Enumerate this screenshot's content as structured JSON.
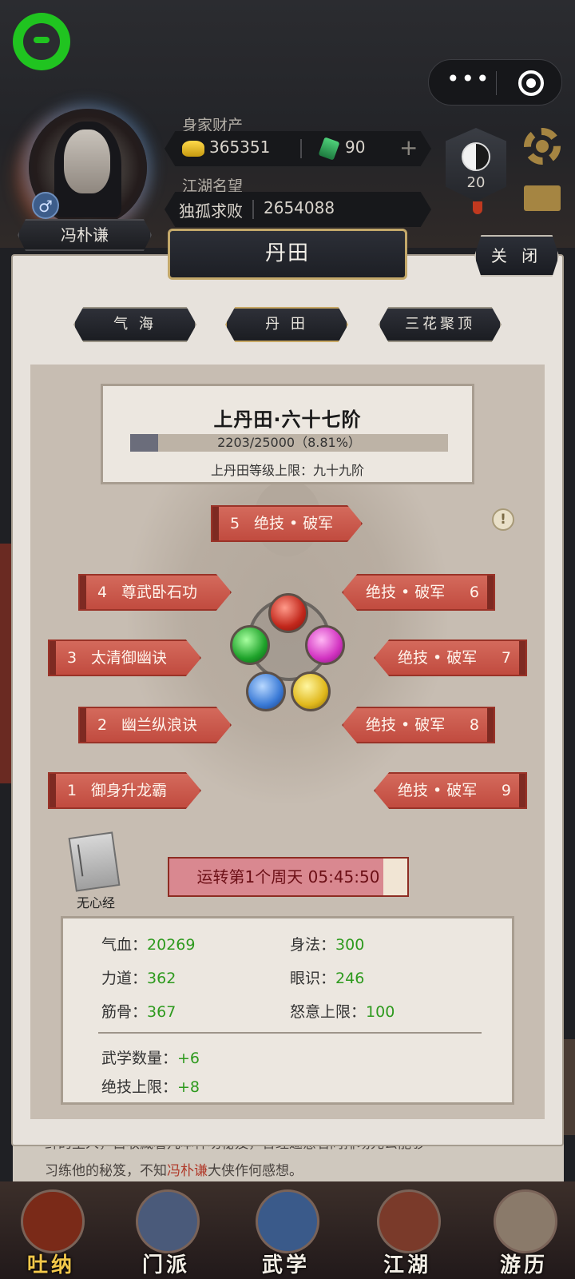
{
  "header": {
    "wealth_label": "身家财产",
    "gold_amount": "365351",
    "jade_amount": "90",
    "plus_symbol": "+",
    "fame_label": "江湖名望",
    "fame_title": "独孤求败",
    "fame_value": "2654088",
    "player_name": "冯朴谦",
    "gender_symbol": "♂",
    "rank_level": "20",
    "capsule_more": "•••"
  },
  "panel": {
    "title": "丹田",
    "close_label": "关 闭",
    "tabs": [
      {
        "label": "气 海"
      },
      {
        "label": "丹 田"
      },
      {
        "label": "三花聚顶"
      }
    ],
    "level": {
      "title": "上丹田·六十七阶",
      "progress_text": "2203/25000（8.81%）",
      "progress_fraction": 0.0881,
      "cap_text": "上丹田等级上限：九十九阶"
    },
    "info_symbol": "!",
    "skills_left": [
      {
        "num": "5",
        "name": "绝技 • 破军"
      },
      {
        "num": "4",
        "name": "尊武卧石功"
      },
      {
        "num": "3",
        "name": "太清御幽诀"
      },
      {
        "num": "2",
        "name": "幽兰纵浪诀"
      },
      {
        "num": "1",
        "name": "御身升龙霸"
      }
    ],
    "skills_right": [
      {
        "num": "6",
        "name": "绝技 • 破军"
      },
      {
        "num": "7",
        "name": "绝技 • 破军"
      },
      {
        "num": "8",
        "name": "绝技 • 破军"
      },
      {
        "num": "9",
        "name": "绝技 • 破军"
      }
    ],
    "scripture_label": "无心经",
    "cycle_text": "运转第1个周天 05:45:50",
    "cycle_fraction": 0.9,
    "stats": {
      "hp_label": "气血：",
      "hp_value": "20269",
      "agility_label": "身法：",
      "agility_value": "300",
      "power_label": "力道：",
      "power_value": "362",
      "insight_label": "眼识：",
      "insight_value": "246",
      "bone_label": "筋骨：",
      "bone_value": "367",
      "rage_label": "怒意上限：",
      "rage_value": "100",
      "martial_count_label": "武学数量：",
      "martial_count_value": "+6",
      "ult_cap_label": "绝技上限：",
      "ult_cap_value": "+8"
    }
  },
  "story": {
    "line1": "鲜的主人，自收藏着几本神功秘笈，曾经邀意名同排场元公能够",
    "line2_pre": "习练他的秘笈，不知",
    "line2_name": "冯朴谦",
    "line2_post": "大侠作何感想。"
  },
  "nav": [
    {
      "label": "吐纳"
    },
    {
      "label": "门派"
    },
    {
      "label": "武学"
    },
    {
      "label": "江湖"
    },
    {
      "label": "游历"
    }
  ],
  "colors": {
    "skill_red": "#c14b3f",
    "stat_green": "#2e9a1e",
    "panel_bg": "#e7e2dc",
    "title_gold_border": "#c3a86a"
  }
}
